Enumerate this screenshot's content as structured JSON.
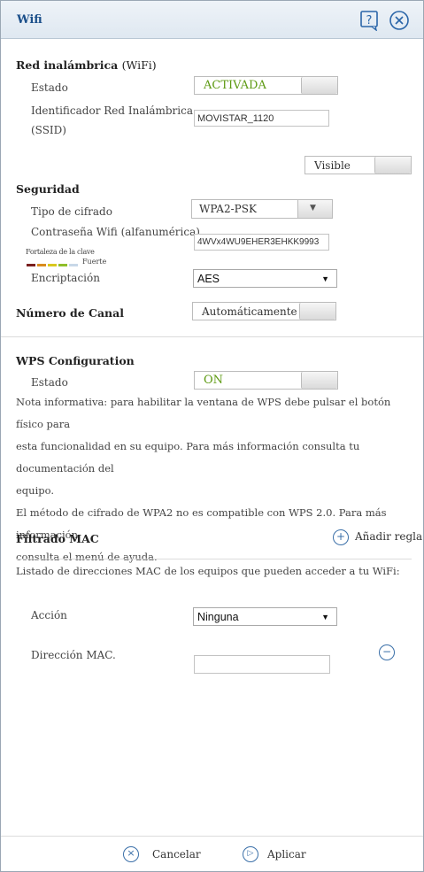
{
  "window": {
    "title": "Wifi"
  },
  "wireless": {
    "section_title": "Red inalámbrica",
    "section_sub": "(WiFi)",
    "estado_label": "Estado",
    "estado_value": "ACTIVADA",
    "ssid_label_1": "Identificador Red Inalámbrica",
    "ssid_label_2": "(SSID)",
    "ssid_value": "MOVISTAR_1120",
    "visibility": "Visible"
  },
  "security": {
    "section_title": "Seguridad",
    "cipher_label": "Tipo de cifrado",
    "cipher_value": "WPA2-PSK",
    "password_label": "Contraseña Wifi (alfanumérica)",
    "password_value": "4WVx4WU9EHER3EHKK9993",
    "strength_label": "Fortaleza de la clave",
    "strength_value": "Fuerte",
    "strength_colors": [
      "#7a1f1f",
      "#d98c1e",
      "#d9c81e",
      "#8fbf2a",
      "#c8d8e8"
    ],
    "encryption_label": "Encriptación",
    "encryption_value": "AES"
  },
  "channel": {
    "label": "Número de Canal",
    "value": "Automáticamente"
  },
  "wps": {
    "section_title": "WPS Configuration",
    "estado_label": "Estado",
    "estado_value": "ON",
    "note_lines": [
      "Nota informativa: para habilitar la ventana de WPS debe pulsar el botón físico para",
      "esta funcionalidad en su equipo. Para más información consulta tu documentación del",
      "equipo.",
      "El método de cifrado de WPA2 no es compatible con WPS 2.0. Para más información",
      "consulta el menú de ayuda."
    ]
  },
  "mac": {
    "section_title": "Filtrado MAC",
    "add_rule": "Añadir regla",
    "description": "Listado de direcciones MAC de los equipos que pueden acceder a tu WiFi:",
    "action_label": "Acción",
    "action_value": "Ninguna",
    "address_label": "Dirección MAC.",
    "address_value": ""
  },
  "footer": {
    "cancel": "Cancelar",
    "apply": "Aplicar"
  },
  "colors": {
    "accent": "#2a65a8",
    "active_text": "#5d9a12"
  }
}
